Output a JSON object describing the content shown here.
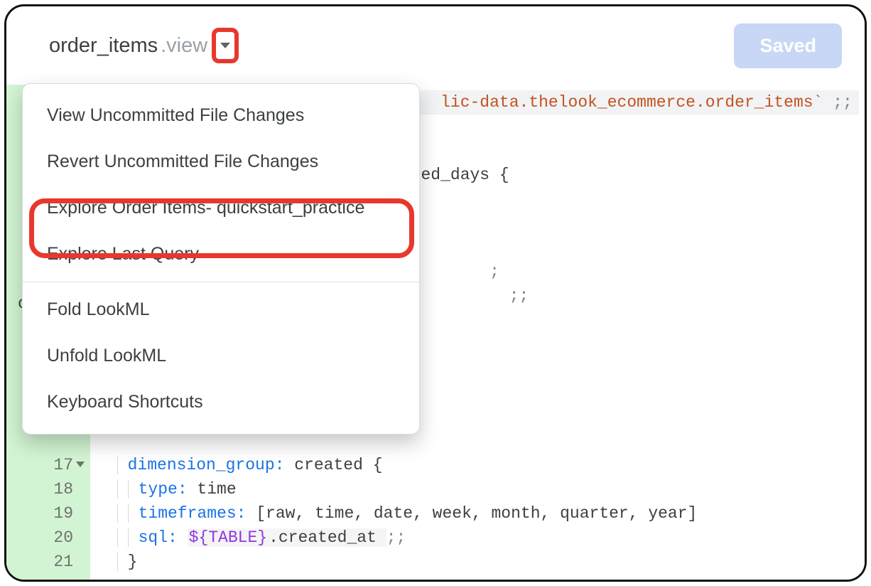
{
  "header": {
    "filename_base": "order_items",
    "filename_ext": ".view",
    "saved_label": "Saved"
  },
  "dropdown": {
    "items": [
      "View Uncommitted File Changes",
      "Revert Uncommitted File Changes",
      "Explore Order Items- quickstart_practice",
      "Explore Last Query",
      "Fold LookML",
      "Unfold LookML",
      "Keyboard Shortcuts"
    ]
  },
  "gutter": {
    "start_blank": true,
    "lines": [
      "",
      "",
      "",
      "",
      "",
      "",
      "",
      "",
      "",
      "",
      "",
      "",
      "",
      "",
      "",
      "17",
      "18",
      "19",
      "20",
      "21"
    ]
  },
  "code": {
    "line1_tail_str": "lic-data.thelook_ecommerce.order_items`",
    "line1_tail_punct": " ;;",
    "line4_tail_id": "ed_days ",
    "line4_tail_brace": "{",
    "line8_tail_punct": ";",
    "line9_tail_punct": " ;;",
    "line17_kw": "dimension_group:",
    "line17_id": " created ",
    "line17_brace": "{",
    "line18_kw": "type:",
    "line18_val": " time",
    "line19_kw": "timeframes:",
    "line19_val": " [raw, time, date, week, month, quarter, year]",
    "line20_kw": "sql:",
    "line20_var": "${TABLE}",
    "line20_tail": ".created_at ",
    "line20_punct": ";;",
    "line21_brace": "}"
  },
  "peek_char": "c"
}
